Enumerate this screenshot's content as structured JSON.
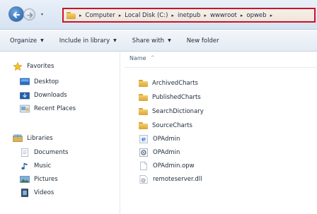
{
  "window": {
    "address_bar": {
      "crumbs": [
        "Computer",
        "Local Disk (C:)",
        "inetpub",
        "wwwroot",
        "opweb"
      ]
    }
  },
  "toolbar": {
    "organize": "Organize",
    "include_in_library": "Include in library",
    "share_with": "Share with",
    "new_folder": "New folder"
  },
  "nav_pane": {
    "favorites": {
      "label": "Favorites",
      "items": [
        "Desktop",
        "Downloads",
        "Recent Places"
      ]
    },
    "libraries": {
      "label": "Libraries",
      "items": [
        "Documents",
        "Music",
        "Pictures",
        "Videos"
      ]
    }
  },
  "file_list": {
    "column_header": "Name",
    "sort_indicator": "^",
    "items": [
      {
        "name": "ArchivedCharts",
        "icon": "folder-icon"
      },
      {
        "name": "PublishedCharts",
        "icon": "folder-icon"
      },
      {
        "name": "SearchDictionary",
        "icon": "folder-icon"
      },
      {
        "name": "SourceCharts",
        "icon": "folder-icon"
      },
      {
        "name": "OPAdmin",
        "icon": "ie-web-icon"
      },
      {
        "name": "OPAdmin",
        "icon": "config-file-icon"
      },
      {
        "name": "OPAdmin.opw",
        "icon": "blank-file-icon"
      },
      {
        "name": "remoteserver.dll",
        "icon": "dll-file-icon"
      }
    ]
  }
}
